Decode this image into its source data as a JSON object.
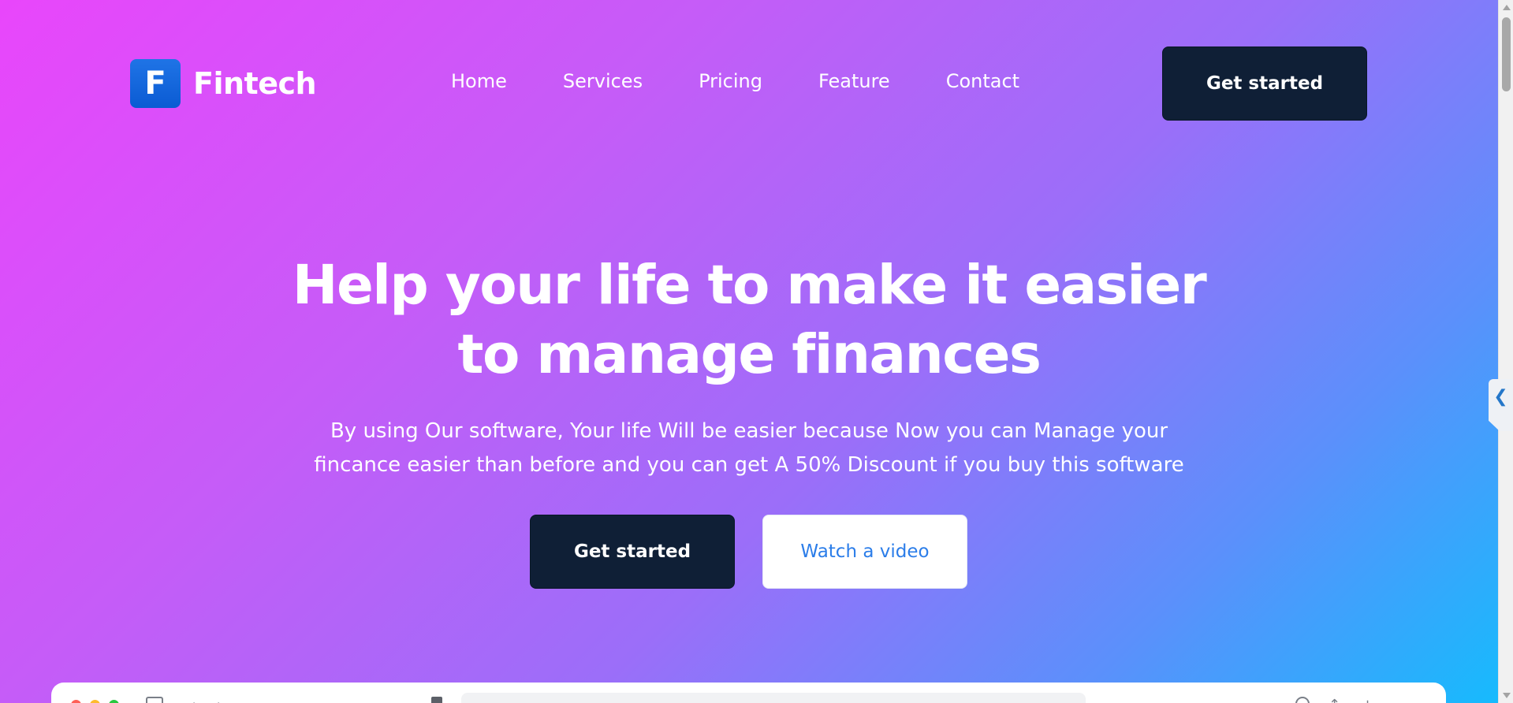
{
  "brand": {
    "logo_letter": "F",
    "name": "Fintech",
    "logo_color": "#0b5bd3"
  },
  "nav": {
    "items": [
      {
        "label": "Home"
      },
      {
        "label": "Services"
      },
      {
        "label": "Pricing"
      },
      {
        "label": "Feature"
      },
      {
        "label": "Contact"
      }
    ]
  },
  "header": {
    "cta_label": "Get started"
  },
  "hero": {
    "title_lines": [
      "Help your life to make it easier",
      "to manage finances"
    ],
    "subtitle_lines": [
      "By using Our software, Your life Will be easier because Now you can Manage your",
      "fincance easier than before and you can get A 50% Discount if you buy this software"
    ],
    "primary_cta": "Get started",
    "secondary_cta": "Watch a video"
  },
  "side_tab": {
    "glyph": "❮"
  },
  "colors": {
    "gradient_start": "#e946fb",
    "gradient_end": "#14bcfd",
    "dark_button": "#0f1f36",
    "link_blue": "#2b7de9"
  },
  "icons": [
    "close-dot-icon",
    "minimize-dot-icon",
    "maximize-dot-icon",
    "sidebar-icon",
    "back-icon",
    "forward-icon",
    "shield-icon",
    "share-icon",
    "add-tab-icon",
    "tabs-icon",
    "collapse-chevron-icon"
  ]
}
